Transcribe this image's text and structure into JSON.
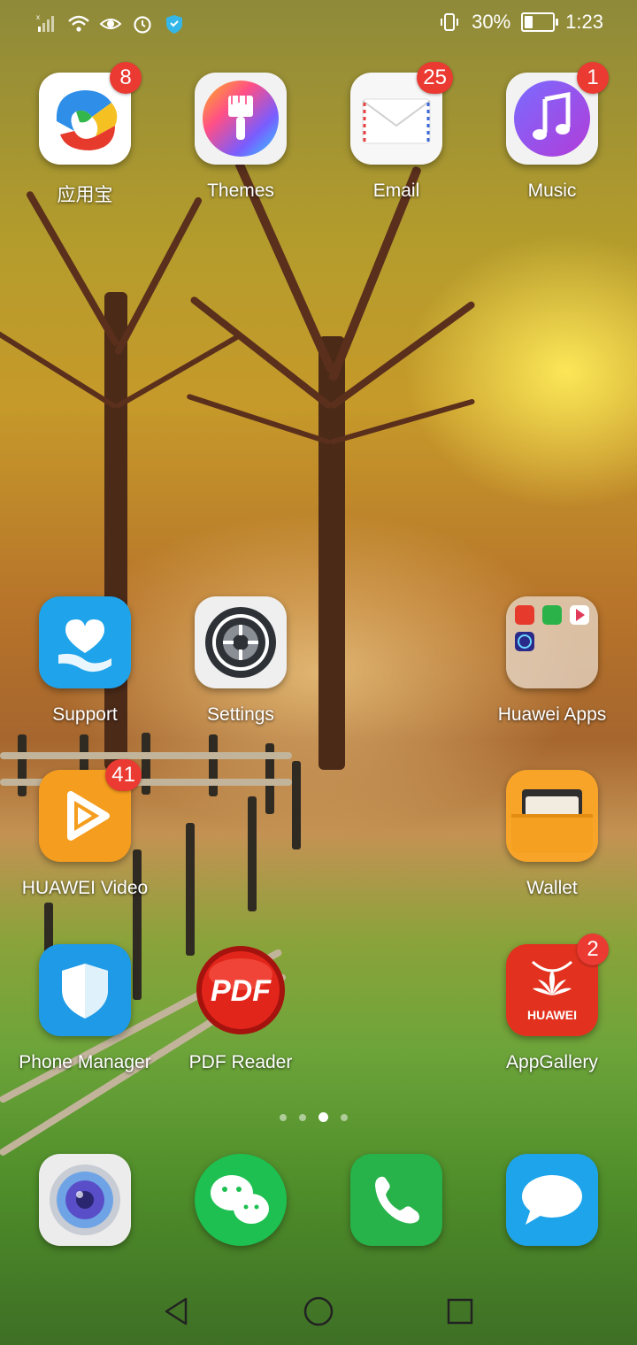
{
  "status_bar": {
    "battery_percent": "30%",
    "time": "1:23",
    "battery_level": 0.3,
    "icons": [
      "signal-icon",
      "wifi-icon",
      "eye-comfort-icon",
      "alarm-icon",
      "shield-icon",
      "vibrate-icon",
      "battery-icon"
    ]
  },
  "apps": {
    "row1": [
      {
        "label": "应用宝",
        "badge": "8"
      },
      {
        "label": "Themes",
        "badge": ""
      },
      {
        "label": "Email",
        "badge": "25"
      },
      {
        "label": "Music",
        "badge": "1"
      }
    ],
    "support": {
      "label": "Support"
    },
    "settings": {
      "label": "Settings"
    },
    "huawei_apps": {
      "label": "Huawei Apps"
    },
    "video": {
      "label": "HUAWEI Video",
      "badge": "41"
    },
    "wallet": {
      "label": "Wallet"
    },
    "phone_manager": {
      "label": "Phone Manager"
    },
    "pdf_reader": {
      "label": "PDF Reader",
      "icon_text": "PDF"
    },
    "appgallery": {
      "label": "AppGallery",
      "badge": "2",
      "icon_text": "HUAWEI"
    }
  },
  "page_indicator": {
    "count": 4,
    "active_index": 2
  },
  "dock": [
    "camera-icon",
    "wechat-icon",
    "phone-icon",
    "messages-icon"
  ],
  "navigation": [
    "back-icon",
    "home-icon",
    "recents-icon"
  ],
  "colors": {
    "badge": "#ea3a32"
  }
}
